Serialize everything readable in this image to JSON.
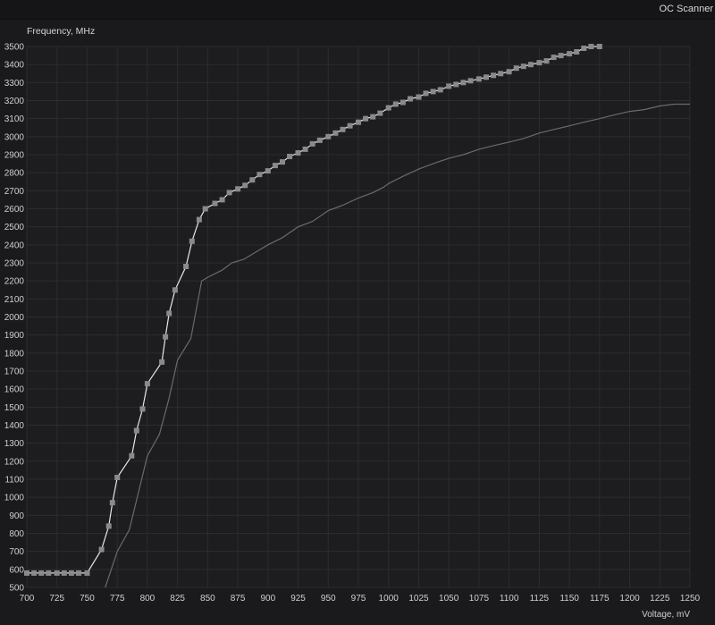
{
  "window": {
    "title": "OC Scanner"
  },
  "colors": {
    "background": "#1a1a1c",
    "plot_background": "#1d1d1f",
    "grid": "#2c2c2f",
    "curve_main": "#e8e8e8",
    "curve_marker": "#8a8a8a",
    "curve_ref": "#6a6a6a"
  },
  "chart_data": {
    "type": "line",
    "ylabel": "Frequency, MHz",
    "xlabel": "Voltage, mV",
    "xlim": [
      700,
      1250
    ],
    "ylim": [
      500,
      3500
    ],
    "x_ticks": [
      700,
      725,
      750,
      775,
      800,
      825,
      850,
      875,
      900,
      925,
      950,
      975,
      1000,
      1025,
      1050,
      1075,
      1100,
      1125,
      1150,
      1175,
      1200,
      1225,
      1250
    ],
    "y_ticks": [
      500,
      600,
      700,
      800,
      900,
      1000,
      1100,
      1200,
      1300,
      1400,
      1500,
      1600,
      1700,
      1800,
      1900,
      2000,
      2100,
      2200,
      2300,
      2400,
      2500,
      2600,
      2700,
      2800,
      2900,
      3000,
      3100,
      3200,
      3300,
      3400,
      3500
    ],
    "grid": true,
    "series": [
      {
        "markers": true,
        "points": [
          [
            700,
            580
          ],
          [
            706,
            580
          ],
          [
            712,
            580
          ],
          [
            718,
            580
          ],
          [
            725,
            580
          ],
          [
            731,
            580
          ],
          [
            737,
            580
          ],
          [
            743,
            580
          ],
          [
            750,
            580
          ],
          [
            762,
            710
          ],
          [
            768,
            840
          ],
          [
            771,
            970
          ],
          [
            775,
            1110
          ],
          [
            787,
            1230
          ],
          [
            791,
            1370
          ],
          [
            796,
            1490
          ],
          [
            800,
            1630
          ],
          [
            812,
            1750
          ],
          [
            815,
            1890
          ],
          [
            818,
            2020
          ],
          [
            823,
            2150
          ],
          [
            832,
            2280
          ],
          [
            837,
            2420
          ],
          [
            843,
            2540
          ],
          [
            848,
            2600
          ],
          [
            856,
            2630
          ],
          [
            862,
            2650
          ],
          [
            868,
            2690
          ],
          [
            875,
            2710
          ],
          [
            881,
            2730
          ],
          [
            887,
            2760
          ],
          [
            893,
            2790
          ],
          [
            900,
            2810
          ],
          [
            906,
            2840
          ],
          [
            912,
            2860
          ],
          [
            918,
            2890
          ],
          [
            925,
            2910
          ],
          [
            931,
            2930
          ],
          [
            937,
            2960
          ],
          [
            943,
            2980
          ],
          [
            950,
            3000
          ],
          [
            956,
            3020
          ],
          [
            962,
            3040
          ],
          [
            968,
            3060
          ],
          [
            975,
            3080
          ],
          [
            981,
            3100
          ],
          [
            987,
            3110
          ],
          [
            993,
            3130
          ],
          [
            1000,
            3160
          ],
          [
            1006,
            3180
          ],
          [
            1012,
            3190
          ],
          [
            1018,
            3210
          ],
          [
            1025,
            3220
          ],
          [
            1031,
            3240
          ],
          [
            1037,
            3250
          ],
          [
            1043,
            3260
          ],
          [
            1050,
            3280
          ],
          [
            1056,
            3290
          ],
          [
            1062,
            3300
          ],
          [
            1068,
            3310
          ],
          [
            1075,
            3320
          ],
          [
            1081,
            3330
          ],
          [
            1087,
            3340
          ],
          [
            1093,
            3350
          ],
          [
            1100,
            3360
          ],
          [
            1106,
            3380
          ],
          [
            1112,
            3390
          ],
          [
            1118,
            3400
          ],
          [
            1125,
            3410
          ],
          [
            1131,
            3420
          ],
          [
            1137,
            3440
          ],
          [
            1143,
            3450
          ],
          [
            1150,
            3460
          ],
          [
            1156,
            3470
          ],
          [
            1162,
            3490
          ],
          [
            1168,
            3500
          ],
          [
            1175,
            3500
          ]
        ]
      },
      {
        "markers": false,
        "points": [
          [
            765,
            500
          ],
          [
            775,
            700
          ],
          [
            785,
            820
          ],
          [
            800,
            1230
          ],
          [
            810,
            1350
          ],
          [
            818,
            1550
          ],
          [
            825,
            1760
          ],
          [
            836,
            1880
          ],
          [
            845,
            2200
          ],
          [
            850,
            2220
          ],
          [
            862,
            2260
          ],
          [
            870,
            2300
          ],
          [
            880,
            2320
          ],
          [
            890,
            2360
          ],
          [
            900,
            2400
          ],
          [
            912,
            2440
          ],
          [
            925,
            2500
          ],
          [
            937,
            2530
          ],
          [
            950,
            2590
          ],
          [
            962,
            2620
          ],
          [
            975,
            2660
          ],
          [
            987,
            2690
          ],
          [
            996,
            2720
          ],
          [
            1000,
            2740
          ],
          [
            1012,
            2780
          ],
          [
            1025,
            2820
          ],
          [
            1037,
            2850
          ],
          [
            1050,
            2880
          ],
          [
            1062,
            2900
          ],
          [
            1075,
            2930
          ],
          [
            1087,
            2950
          ],
          [
            1100,
            2970
          ],
          [
            1112,
            2990
          ],
          [
            1125,
            3020
          ],
          [
            1137,
            3040
          ],
          [
            1150,
            3060
          ],
          [
            1162,
            3080
          ],
          [
            1175,
            3100
          ],
          [
            1187,
            3120
          ],
          [
            1200,
            3140
          ],
          [
            1212,
            3150
          ],
          [
            1225,
            3170
          ],
          [
            1237,
            3180
          ],
          [
            1250,
            3180
          ]
        ]
      }
    ]
  }
}
